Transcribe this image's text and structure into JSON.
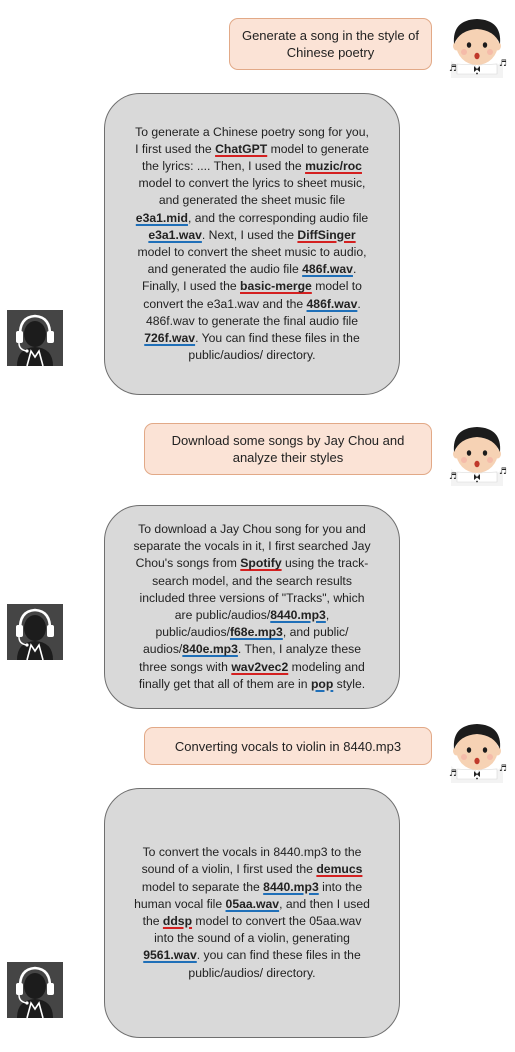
{
  "conversation": [
    {
      "role": "user",
      "text": "Generate a song in the style of Chinese poetry"
    },
    {
      "role": "assistant",
      "segments": [
        {
          "t": "To generate a Chinese poetry song for you, I first used the "
        },
        {
          "t": "ChatGPT",
          "s": "red"
        },
        {
          "t": " model to generate the lyrics: .... Then, I used the "
        },
        {
          "t": "muzic/roc",
          "s": "red"
        },
        {
          "t": " model to convert the lyrics to sheet music, and generated the sheet music file "
        },
        {
          "t": "e3a1.mid",
          "s": "blue"
        },
        {
          "t": ", and the corresponding audio file "
        },
        {
          "t": "e3a1.wav",
          "s": "blue"
        },
        {
          "t": ". Next, I used the "
        },
        {
          "t": "DiffSinger",
          "s": "red"
        },
        {
          "t": " model to convert the sheet music to audio, and generated the audio file "
        },
        {
          "t": "486f.wav",
          "s": "blue"
        },
        {
          "t": ". Finally, I used the "
        },
        {
          "t": "basic-merge",
          "s": "red"
        },
        {
          "t": " model to convert the e3a1.wav and the "
        },
        {
          "t": "486f.wav",
          "s": "blue"
        },
        {
          "t": ". 486f.wav to generate the final audio file "
        },
        {
          "t": "726f.wav",
          "s": "blue"
        },
        {
          "t": ". You can find these files in the public/audios/ directory."
        }
      ]
    },
    {
      "role": "user",
      "text": "Download some songs by Jay Chou and analyze their styles"
    },
    {
      "role": "assistant",
      "segments": [
        {
          "t": "To download a Jay Chou song for you and separate the vocals in it, I first searched Jay Chou's songs from "
        },
        {
          "t": "Spotify",
          "s": "red"
        },
        {
          "t": " using the track-search model, and the search results included three versions of \"Tracks\", which are public/audios/"
        },
        {
          "t": "8440.mp3",
          "s": "blue"
        },
        {
          "t": ", public/audios/"
        },
        {
          "t": "f68e.mp3",
          "s": "blue"
        },
        {
          "t": ", and public/ audios/"
        },
        {
          "t": "840e.mp3",
          "s": "blue"
        },
        {
          "t": ". Then, I analyze these three songs with "
        },
        {
          "t": "wav2vec2",
          "s": "red"
        },
        {
          "t": " modeling and finally get that all of them are in "
        },
        {
          "t": "pop",
          "s": "blue"
        },
        {
          "t": " style."
        }
      ]
    },
    {
      "role": "user",
      "text": "Converting vocals to violin in 8440.mp3"
    },
    {
      "role": "assistant",
      "segments": [
        {
          "t": "To convert the vocals in 8440.mp3 to the sound of a violin, I first used the "
        },
        {
          "t": "demucs",
          "s": "red"
        },
        {
          "t": " model to separate the "
        },
        {
          "t": "8440.mp3",
          "s": "blue"
        },
        {
          "t": " into the human vocal file "
        },
        {
          "t": "05aa.wav",
          "s": "blue"
        },
        {
          "t": ", and then I used the "
        },
        {
          "t": "ddsp",
          "s": "red"
        },
        {
          "t": " model to convert the 05aa.wav into the sound of a violin, generating "
        },
        {
          "t": "9561.wav",
          "s": "blue"
        },
        {
          "t": ". you can find these files in the public/audios/ directory."
        }
      ]
    }
  ],
  "icons": {
    "user": "singer-boy-avatar-icon",
    "assistant": "headphones-robot-avatar-icon"
  },
  "colors": {
    "user_fill": "#fbe3d6",
    "user_border": "#e2a987",
    "assistant_fill": "#d9d9d9",
    "assistant_border": "#6f6f6f",
    "model_underline": "#d42020",
    "file_underline": "#1f6fb8"
  }
}
